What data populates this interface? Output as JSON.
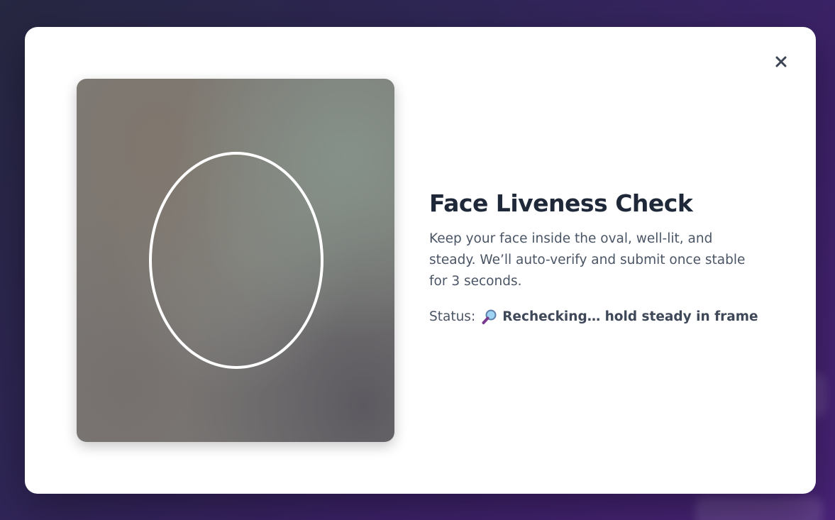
{
  "modal": {
    "title": "Face Liveness Check",
    "description": "Keep your face inside the oval, well-lit, and steady. We’ll auto-verify and submit once stable for 3 seconds.",
    "status_label": "Status:",
    "status_icon": "magnifying-glass-icon",
    "status_text": "Rechecking… hold steady in frame",
    "close_icon": "close-icon"
  },
  "colors": {
    "title": "#1f2838",
    "body_text": "#4a5565",
    "oval": "#ffffff",
    "backdrop": "#3c2268"
  }
}
